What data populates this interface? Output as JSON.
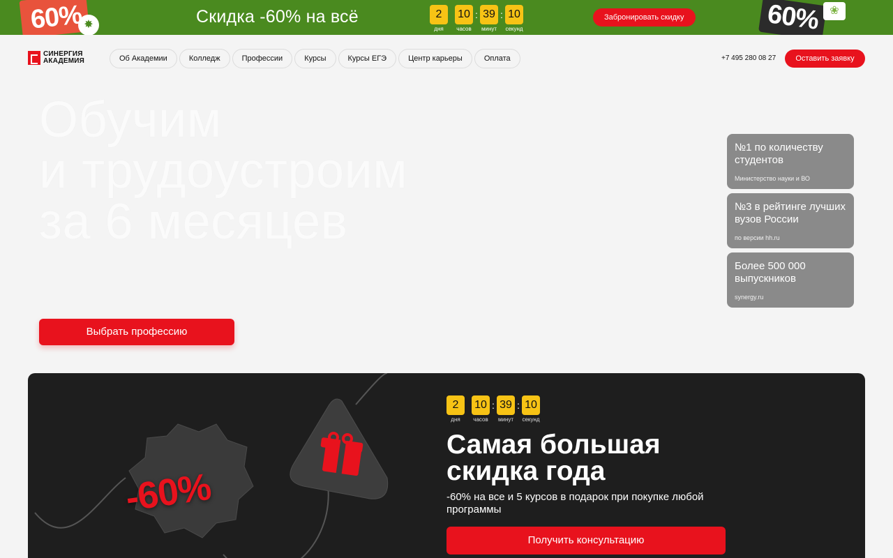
{
  "promo": {
    "badge_left": "60%",
    "clover_icon": "clover-icon",
    "title": "Скидка -60% на всё",
    "countdown": [
      {
        "value": "2",
        "label": "дня"
      },
      {
        "value": "10",
        "label": "часов"
      },
      {
        "value": "39",
        "label": "минут"
      },
      {
        "value": "10",
        "label": "секунд"
      }
    ],
    "separator": ":",
    "cta": "Забронировать скидку",
    "badge_right": "60%",
    "tulip_icon": "tulip-icon"
  },
  "header": {
    "logo_line1": "СИНЕРГИЯ",
    "logo_line2": "АКАДЕМИЯ",
    "nav": [
      "Об Академии",
      "Колледж",
      "Профессии",
      "Курсы",
      "Курсы ЕГЭ",
      "Центр карьеры",
      "Оплата"
    ],
    "phone": "+7 495 280 08 27",
    "cta": "Оставить заявку"
  },
  "hero": {
    "title_lines": [
      "Обучим",
      "и трудоустроим",
      "за 6 месяцев"
    ],
    "stats": [
      {
        "title": "№1 по количеству студентов",
        "source": "Министерство науки и ВО"
      },
      {
        "title": "№3 в рейтинге лучших вузов России",
        "source": "по версии hh.ru"
      },
      {
        "title": "Более 500 000 выпускников",
        "source": "synergy.ru"
      }
    ],
    "cta": "Выбрать профессию"
  },
  "sale": {
    "badge": "-60%",
    "gift_icon": "gift-icon",
    "countdown": [
      {
        "value": "2",
        "label": "дня"
      },
      {
        "value": "10",
        "label": "часов"
      },
      {
        "value": "39",
        "label": "минут"
      },
      {
        "value": "10",
        "label": "секунд"
      }
    ],
    "title_line1": "Самая большая",
    "title_line2": "скидка года",
    "subtitle": "-60% на все и 5 курсов в подарок при покупке любой программы",
    "cta": "Получить консультацию"
  },
  "colors": {
    "promo_bg": "#4a8a1f",
    "accent_red": "#e8121d",
    "countdown_yellow": "#f7c315",
    "dark_block": "#1e1e1e",
    "stat_card": "#8a8a8a"
  }
}
